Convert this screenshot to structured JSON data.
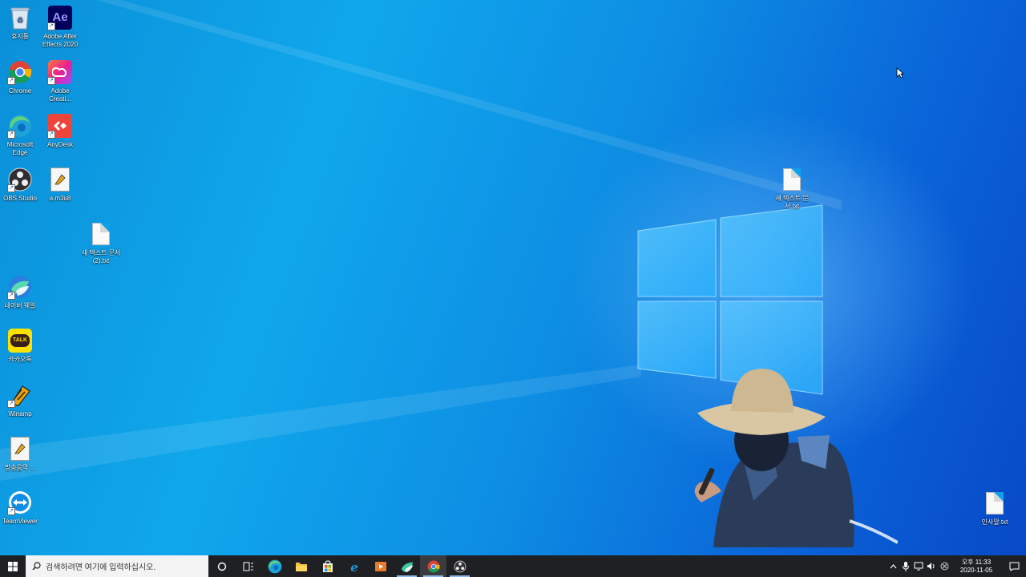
{
  "desktop": {
    "icons_left": [
      {
        "label": "휴지통",
        "icon": "recycle-bin-icon"
      },
      {
        "label": "Adobe After Effects 2020",
        "icon": "after-effects-icon"
      },
      {
        "label": "Chrome",
        "icon": "chrome-icon"
      },
      {
        "label": "Adobe Creati...",
        "icon": "creative-cloud-icon"
      },
      {
        "label": "Microsoft Edge",
        "icon": "edge-icon"
      },
      {
        "label": "AnyDesk",
        "icon": "anydesk-icon"
      },
      {
        "label": "OBS Studio",
        "icon": "obs-icon"
      },
      {
        "label": "a.m3u8",
        "icon": "playlist-file-icon"
      },
      {
        "label": "새 텍스트 문서 (2).txt",
        "icon": "text-file-icon"
      },
      {
        "label": "네이버 웨일",
        "icon": "whale-icon"
      },
      {
        "label": "카카오톡",
        "icon": "kakaotalk-icon"
      },
      {
        "label": "Winamp",
        "icon": "winamp-icon"
      },
      {
        "label": "방송음악 ...",
        "icon": "playlist-file-icon"
      },
      {
        "label": "TeamViewer",
        "icon": "teamviewer-icon"
      }
    ],
    "icons_right": [
      {
        "label": "새 텍스트 문서.txt",
        "icon": "text-file-icon"
      },
      {
        "label": "인사말.txt",
        "icon": "text-file-icon"
      }
    ],
    "ae_text": "Ae",
    "talk_text": "TALK"
  },
  "taskbar": {
    "search_placeholder": "검색하려면 여기에 입력하십시오.",
    "apps": [
      {
        "name": "cortana-icon"
      },
      {
        "name": "task-view-icon"
      },
      {
        "name": "edge-icon"
      },
      {
        "name": "file-explorer-icon"
      },
      {
        "name": "store-icon"
      },
      {
        "name": "ie-icon"
      },
      {
        "name": "media-player-icon"
      },
      {
        "name": "whale-icon"
      },
      {
        "name": "chrome-icon"
      },
      {
        "name": "obs-icon"
      }
    ],
    "clock": {
      "time": "오후 11:33",
      "date": "2020-11-05"
    }
  },
  "colors": {
    "taskbar_bg": "#1f2023",
    "desktop_accent": "#0a8fd8"
  }
}
